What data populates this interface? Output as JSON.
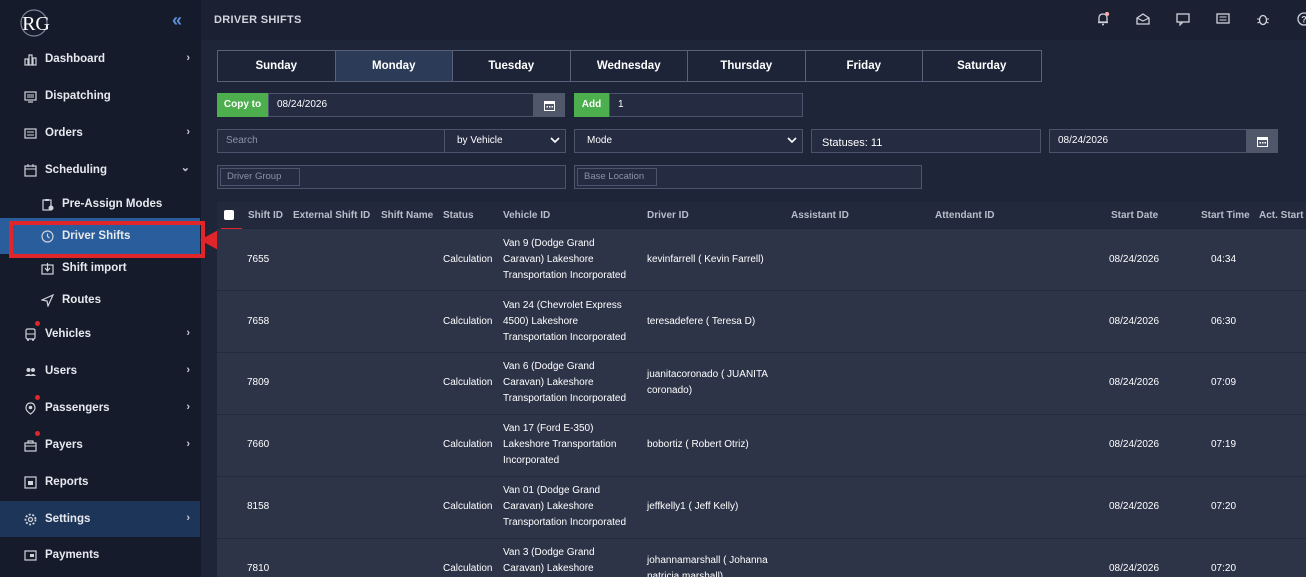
{
  "app": {
    "logo_text": "RG",
    "page_title": "DRIVER SHIFTS"
  },
  "sidebar": {
    "items": [
      {
        "label": "Dashboard",
        "icon": "bar-chart-icon",
        "has_chevron": true
      },
      {
        "label": "Dispatching",
        "icon": "monitor-icon",
        "has_chevron": false
      },
      {
        "label": "Orders",
        "icon": "list-icon",
        "has_chevron": true
      },
      {
        "label": "Scheduling",
        "icon": "calendar-icon",
        "has_chevron": true,
        "expanded": true
      },
      {
        "label": "Pre-Assign Modes",
        "icon": "clipboard-lock-icon",
        "sub": true
      },
      {
        "label": "Driver Shifts",
        "icon": "clock-icon",
        "sub": true,
        "active": true
      },
      {
        "label": "Shift import",
        "icon": "import-icon",
        "sub": true
      },
      {
        "label": "Routes",
        "icon": "navigation-icon",
        "sub": true
      },
      {
        "label": "Vehicles",
        "icon": "bus-icon",
        "has_chevron": true,
        "badge": true
      },
      {
        "label": "Users",
        "icon": "users-icon",
        "has_chevron": true
      },
      {
        "label": "Passengers",
        "icon": "passenger-icon",
        "has_chevron": true,
        "badge": true
      },
      {
        "label": "Payers",
        "icon": "briefcase-icon",
        "has_chevron": true,
        "badge": true
      },
      {
        "label": "Reports",
        "icon": "report-icon",
        "has_chevron": false
      },
      {
        "label": "Settings",
        "icon": "gear-icon",
        "has_chevron": true
      },
      {
        "label": "Payments",
        "icon": "payment-icon",
        "has_chevron": false
      }
    ]
  },
  "days": [
    "Sunday",
    "Monday",
    "Tuesday",
    "Wednesday",
    "Thursday",
    "Friday",
    "Saturday"
  ],
  "active_day": "Monday",
  "controls": {
    "copy_to_label": "Copy to",
    "copy_to_date": "08/24/2026",
    "add_label": "Add",
    "add_value": "1",
    "search_placeholder": "Search",
    "by_select": "by Vehicle",
    "mode_select": "Mode",
    "statuses": "Statuses: 11",
    "filter_date": "08/24/2026",
    "driver_group_placeholder": "Driver Group",
    "base_location_placeholder": "Base Location"
  },
  "table": {
    "headers": [
      "Shift ID",
      "External Shift ID",
      "Shift Name",
      "Status",
      "Vehicle ID",
      "Driver ID",
      "Assistant ID",
      "Attendant ID",
      "Start Date",
      "Start Time",
      "Act. Start T"
    ],
    "rows": [
      {
        "shift_id": "7655",
        "status": "Calculation",
        "vehicle": [
          "Van 9  (Dodge Grand",
          "Caravan)   Lakeshore",
          "Transportation Incorporated"
        ],
        "driver": [
          "kevinfarrell ( Kevin Farrell)"
        ],
        "start_date": "08/24/2026",
        "start_time": "04:34"
      },
      {
        "shift_id": "7658",
        "status": "Calculation",
        "vehicle": [
          "Van 24  (Chevrolet Express",
          "4500)   Lakeshore",
          "Transportation Incorporated"
        ],
        "driver": [
          "teresadefere ( Teresa D)"
        ],
        "start_date": "08/24/2026",
        "start_time": "06:30"
      },
      {
        "shift_id": "7809",
        "status": "Calculation",
        "vehicle": [
          "Van 6  (Dodge Grand",
          "Caravan)   Lakeshore",
          "Transportation Incorporated"
        ],
        "driver": [
          "juanitacoronado ( JUANITA",
          "coronado)"
        ],
        "start_date": "08/24/2026",
        "start_time": "07:09"
      },
      {
        "shift_id": "7660",
        "status": "Calculation",
        "vehicle": [
          "Van 17  (Ford E-350)",
          "Lakeshore Transportation",
          "Incorporated"
        ],
        "driver": [
          "bobortiz ( Robert Otriz)"
        ],
        "start_date": "08/24/2026",
        "start_time": "07:19"
      },
      {
        "shift_id": "8158",
        "status": "Calculation",
        "vehicle": [
          "Van 01  (Dodge Grand",
          "Caravan)   Lakeshore",
          "Transportation Incorporated"
        ],
        "driver": [
          "jeffkelly1 ( Jeff Kelly)"
        ],
        "start_date": "08/24/2026",
        "start_time": "07:20"
      },
      {
        "shift_id": "7810",
        "status": "Calculation",
        "vehicle": [
          "Van 3  (Dodge Grand",
          "Caravan)   Lakeshore"
        ],
        "driver": [
          "johannamarshall ( Johanna",
          "patricia marshall)"
        ],
        "start_date": "08/24/2026",
        "start_time": "07:20"
      }
    ]
  }
}
